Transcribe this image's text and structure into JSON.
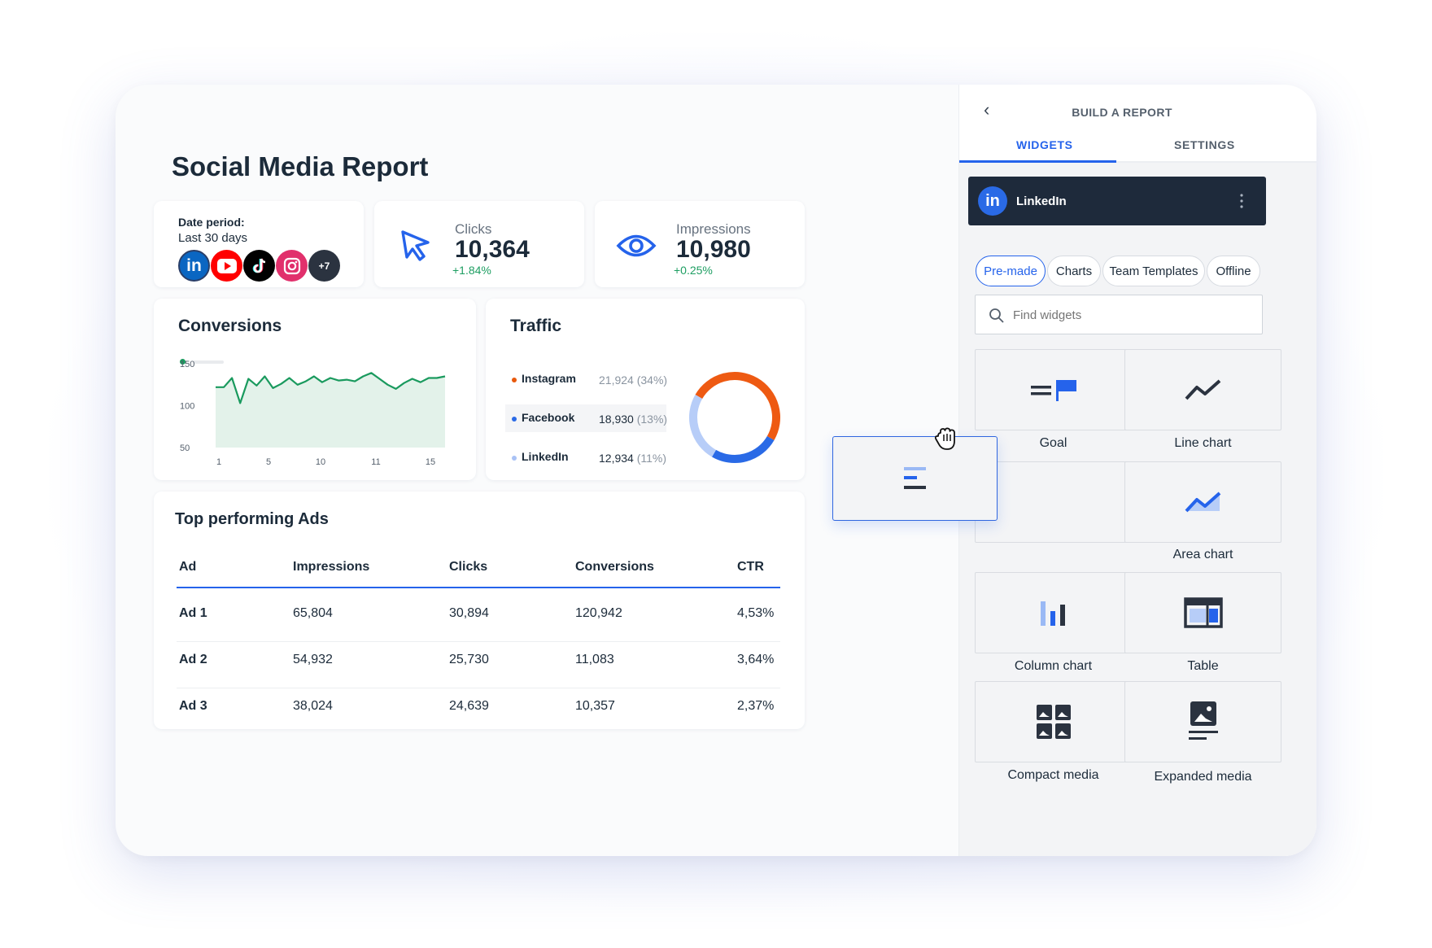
{
  "report": {
    "title": "Social Media Report",
    "date_label": "Date period:",
    "date_value": "Last 30 days",
    "more_networks": "+7"
  },
  "metrics": {
    "clicks": {
      "label": "Clicks",
      "value": "10,364",
      "delta": "+1.84%",
      "icon": "cursor-icon"
    },
    "impressions": {
      "label": "Impressions",
      "value": "10,980",
      "delta": "+0.25%",
      "icon": "eye-icon"
    }
  },
  "conversions": {
    "title": "Conversions",
    "chart_data": {
      "type": "area",
      "x": [
        1,
        2,
        3,
        4,
        5,
        6,
        7,
        8,
        9,
        10,
        11,
        12,
        13,
        14,
        15,
        16,
        17,
        18,
        19,
        20,
        21,
        22,
        23,
        24,
        25,
        26,
        27,
        28,
        29
      ],
      "y": [
        122,
        122,
        133,
        103,
        132,
        124,
        135,
        121,
        126,
        133,
        125,
        129,
        135,
        128,
        133,
        130,
        131,
        129,
        135,
        139,
        132,
        125,
        120,
        127,
        132,
        128,
        133,
        133,
        135
      ],
      "x_ticks": [
        "1",
        "5",
        "10",
        "11",
        "15"
      ],
      "y_ticks": [
        "150",
        "100",
        "50"
      ],
      "ylim": [
        50,
        150
      ],
      "color": "#1a9a5e",
      "fill": "#e3f2ea"
    }
  },
  "traffic": {
    "title": "Traffic",
    "rows": [
      {
        "name": "Instagram",
        "value": "21,924",
        "pct": "(34%)",
        "color": "#e8590c"
      },
      {
        "name": "Facebook",
        "value": "18,930",
        "pct": "(13%)",
        "color": "#2a6ae6"
      },
      {
        "name": "LinkedIn",
        "value": "12,934",
        "pct": "(11%)",
        "color": "#a9c2f5"
      }
    ],
    "chart_data": {
      "type": "pie",
      "categories": [
        "Instagram",
        "Facebook",
        "LinkedIn"
      ],
      "values": [
        50,
        25,
        25
      ],
      "colors": [
        "#ee5a12",
        "#2a6ae6",
        "#b7cdf8"
      ]
    }
  },
  "ads": {
    "title": "Top performing Ads",
    "columns": [
      "Ad",
      "Impressions",
      "Clicks",
      "Conversions",
      "CTR"
    ],
    "rows": [
      [
        "Ad 1",
        "65,804",
        "30,894",
        "120,942",
        "4,53%"
      ],
      [
        "Ad 2",
        "54,932",
        "25,730",
        "11,083",
        "3,64%"
      ],
      [
        "Ad 3",
        "38,024",
        "24,639",
        "10,357",
        "2,37%"
      ]
    ]
  },
  "panel": {
    "title": "BUILD A REPORT",
    "tabs": [
      "WIDGETS",
      "SETTINGS"
    ],
    "source": "LinkedIn",
    "filters": [
      "Pre-made",
      "Charts",
      "Team Templates",
      "Offline"
    ],
    "search_placeholder": "Find widgets",
    "widgets": [
      "Goal",
      "Line chart",
      "",
      "Area chart",
      "Column chart",
      "Table",
      "Compact media",
      "Expanded media"
    ]
  },
  "colors": {
    "accent": "#2563eb",
    "navy": "#1e2a3b",
    "green": "#1e9e62"
  }
}
